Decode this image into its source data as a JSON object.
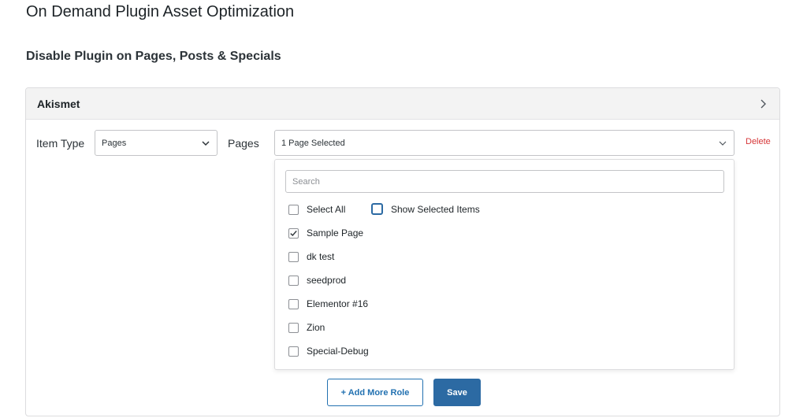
{
  "page": {
    "title": "On Demand Plugin Asset Optimization",
    "subtitle": "Disable Plugin on Pages, Posts & Specials"
  },
  "panel": {
    "title": "Akismet",
    "expand_icon": "chevron-right-icon"
  },
  "filters": {
    "item_type_label": "Item Type",
    "item_type_value": "Pages",
    "pages_label": "Pages",
    "pages_value": "1 Page Selected",
    "delete_label": "Delete"
  },
  "dropdown": {
    "search_placeholder": "Search",
    "select_all_label": "Select All",
    "select_all_checked": false,
    "show_selected_label": "Show Selected Items",
    "show_selected_checked": false,
    "items": [
      {
        "label": "Sample Page",
        "checked": true
      },
      {
        "label": "dk test",
        "checked": false
      },
      {
        "label": "seedprod",
        "checked": false
      },
      {
        "label": "Elementor #16",
        "checked": false
      },
      {
        "label": "Zion",
        "checked": false
      },
      {
        "label": "Special-Debug",
        "checked": false
      }
    ]
  },
  "actions": {
    "add_role_label": "+ Add More Role",
    "save_label": "Save"
  },
  "colors": {
    "primary": "#2c6aa3",
    "danger": "#d63638"
  }
}
